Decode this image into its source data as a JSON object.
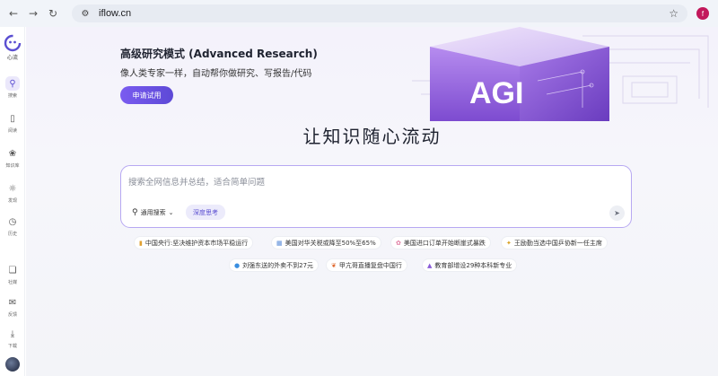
{
  "browser": {
    "url": "iflow.cn",
    "profile_initial": "f"
  },
  "sidebar": {
    "logo_label": "心流",
    "items": [
      {
        "label": "搜索",
        "icon": "search-icon"
      },
      {
        "label": "阅读",
        "icon": "book-icon"
      },
      {
        "label": "知识库",
        "icon": "knowledge-icon"
      },
      {
        "label": "发现",
        "icon": "compass-icon"
      },
      {
        "label": "历史",
        "icon": "clock-icon"
      },
      {
        "label": "社媒",
        "icon": "social-icon"
      },
      {
        "label": "反馈",
        "icon": "feedback-icon"
      },
      {
        "label": "下载",
        "icon": "download-icon"
      }
    ]
  },
  "banner": {
    "title": "高级研究模式 (Advanced Research)",
    "subtitle": "像人类专家一样，自动帮你做研究、写报告/代码",
    "button": "申请试用",
    "art_text": "AGI"
  },
  "headline": "让知识随心流动",
  "search": {
    "placeholder": "搜索全网信息并总结，适合简单问题",
    "mode": "通用搜索",
    "deep_label": "深度思考"
  },
  "suggestions": [
    {
      "text": "中国央行:坚决维护资本市场平稳运行",
      "icon": "chart-icon"
    },
    {
      "text": "美国对华关税或降至50%至65%",
      "icon": "document-icon"
    },
    {
      "text": "美国进口订单开始断崖式暴跌",
      "icon": "flower-icon"
    },
    {
      "text": "王励勤当选中国乒协新一任主席",
      "icon": "sparkle-icon"
    },
    {
      "text": "刘强东送的外卖不到27元",
      "icon": "globe-icon"
    },
    {
      "text": "甲亢哥直播复盘中国行",
      "icon": "leaf-icon"
    },
    {
      "text": "教育部增设29种本科新专业",
      "icon": "graduation-icon"
    }
  ],
  "colors": {
    "accent": "#5b4fd1",
    "button_gradient_start": "#7a5cf0",
    "search_border": "#b7a8f2"
  }
}
